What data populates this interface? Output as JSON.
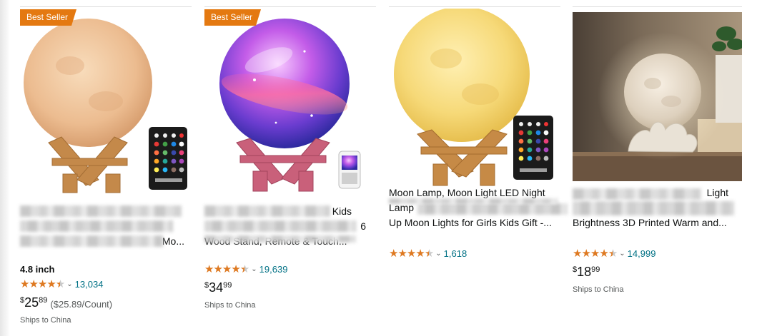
{
  "products": [
    {
      "badge": "Best Seller",
      "image_alt": "moon lamp with wooden stand and remote",
      "title_lines": [
        "",
        "",
        "Mo..."
      ],
      "size": "4.8 inch",
      "stars": "4.5",
      "reviews": "13,034",
      "price": {
        "currency": "$",
        "whole": "25",
        "fraction": "89",
        "per_unit": "($25.89/Count)"
      },
      "shipping": "Ships to China"
    },
    {
      "badge": "Best Seller",
      "image_alt": "galaxy moon lamp with remote",
      "title_lines": [
        "Kids",
        "6",
        "Wood Stand, Remote & Touch..."
      ],
      "stars": "4.5",
      "reviews": "19,639",
      "price": {
        "currency": "$",
        "whole": "34",
        "fraction": "99"
      },
      "shipping": "Ships to China"
    },
    {
      "image_alt": "yellow moon lamp with remote control",
      "title_lines": [
        "Moon Lamp, Moon Light LED Night",
        "Lamp",
        "Up Moon Lights for Girls Kids Gift -..."
      ],
      "stars": "4.5",
      "reviews": "1,618"
    },
    {
      "image_alt": "moon lamp on hand-shaped holder",
      "title_lines": [
        "Light",
        "",
        "Brightness 3D Printed Warm and..."
      ],
      "stars": "4.5",
      "reviews": "14,999",
      "price": {
        "currency": "$",
        "whole": "18",
        "fraction": "99"
      },
      "shipping": "Ships to China"
    }
  ]
}
